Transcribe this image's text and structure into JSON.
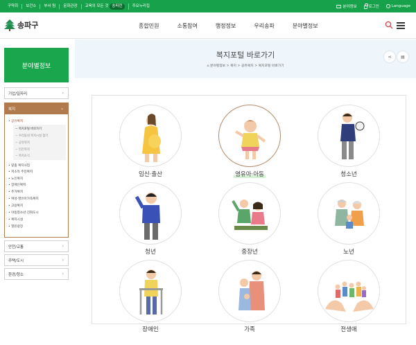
{
  "topbar": {
    "left": [
      "구약회",
      "보건소",
      "부서 팀",
      "문화관광",
      "교육의 모든 것",
      "주요누리집"
    ],
    "left_badge": "송파런",
    "right": {
      "sitemap": "분야정보",
      "login": "로그인",
      "language": "Language"
    }
  },
  "header": {
    "logo": "송파구",
    "gnb": [
      "종합민원",
      "소통참여",
      "행정정보",
      "우리송파",
      "분야별정보"
    ]
  },
  "banner": {
    "title": "복지포털 바로가기",
    "breadcrumb": "분야별정보 > 복지 > 공유복지 > 복지포털 바로가기"
  },
  "sidebar": {
    "title": "분야별정보",
    "items_top": [
      "기업/일자리"
    ],
    "open_item": "복지",
    "level2": [
      "공유복지",
      "맞춤 복지사업",
      "저소득 주민복지",
      "노인복지",
      "장애인복지",
      "주거복지",
      "여성·영유아가족복지",
      "고용복지",
      "아동청소년 친화도시",
      "복지시설",
      "열린광장"
    ],
    "level3": [
      "복지포털 바로가기",
      "우리동네 복지시설 찾기",
      "공유복지",
      "민간복지",
      "복지소식"
    ],
    "items_bottom": [
      "안전/교통",
      "주택/도시",
      "환경/청소"
    ]
  },
  "grid": [
    {
      "label": "임신·출산",
      "icon": "pregnant-woman-icon"
    },
    {
      "label": "영유아·아동",
      "icon": "child-icon",
      "active": true
    },
    {
      "label": "청소년",
      "icon": "teenager-icon"
    },
    {
      "label": "청년",
      "icon": "young-adult-icon"
    },
    {
      "label": "중장년",
      "icon": "middle-aged-icon"
    },
    {
      "label": "노년",
      "icon": "elderly-icon"
    },
    {
      "label": "장애인",
      "icon": "disabled-person-icon"
    },
    {
      "label": "가족",
      "icon": "family-icon"
    },
    {
      "label": "전생애",
      "icon": "lifetime-icon"
    }
  ],
  "colors": {
    "topbar": "#17a14a",
    "sidebar_title": "#1aa64c",
    "sidebar_open": "#b07a4d",
    "banner_bg": "#eef6fb"
  }
}
